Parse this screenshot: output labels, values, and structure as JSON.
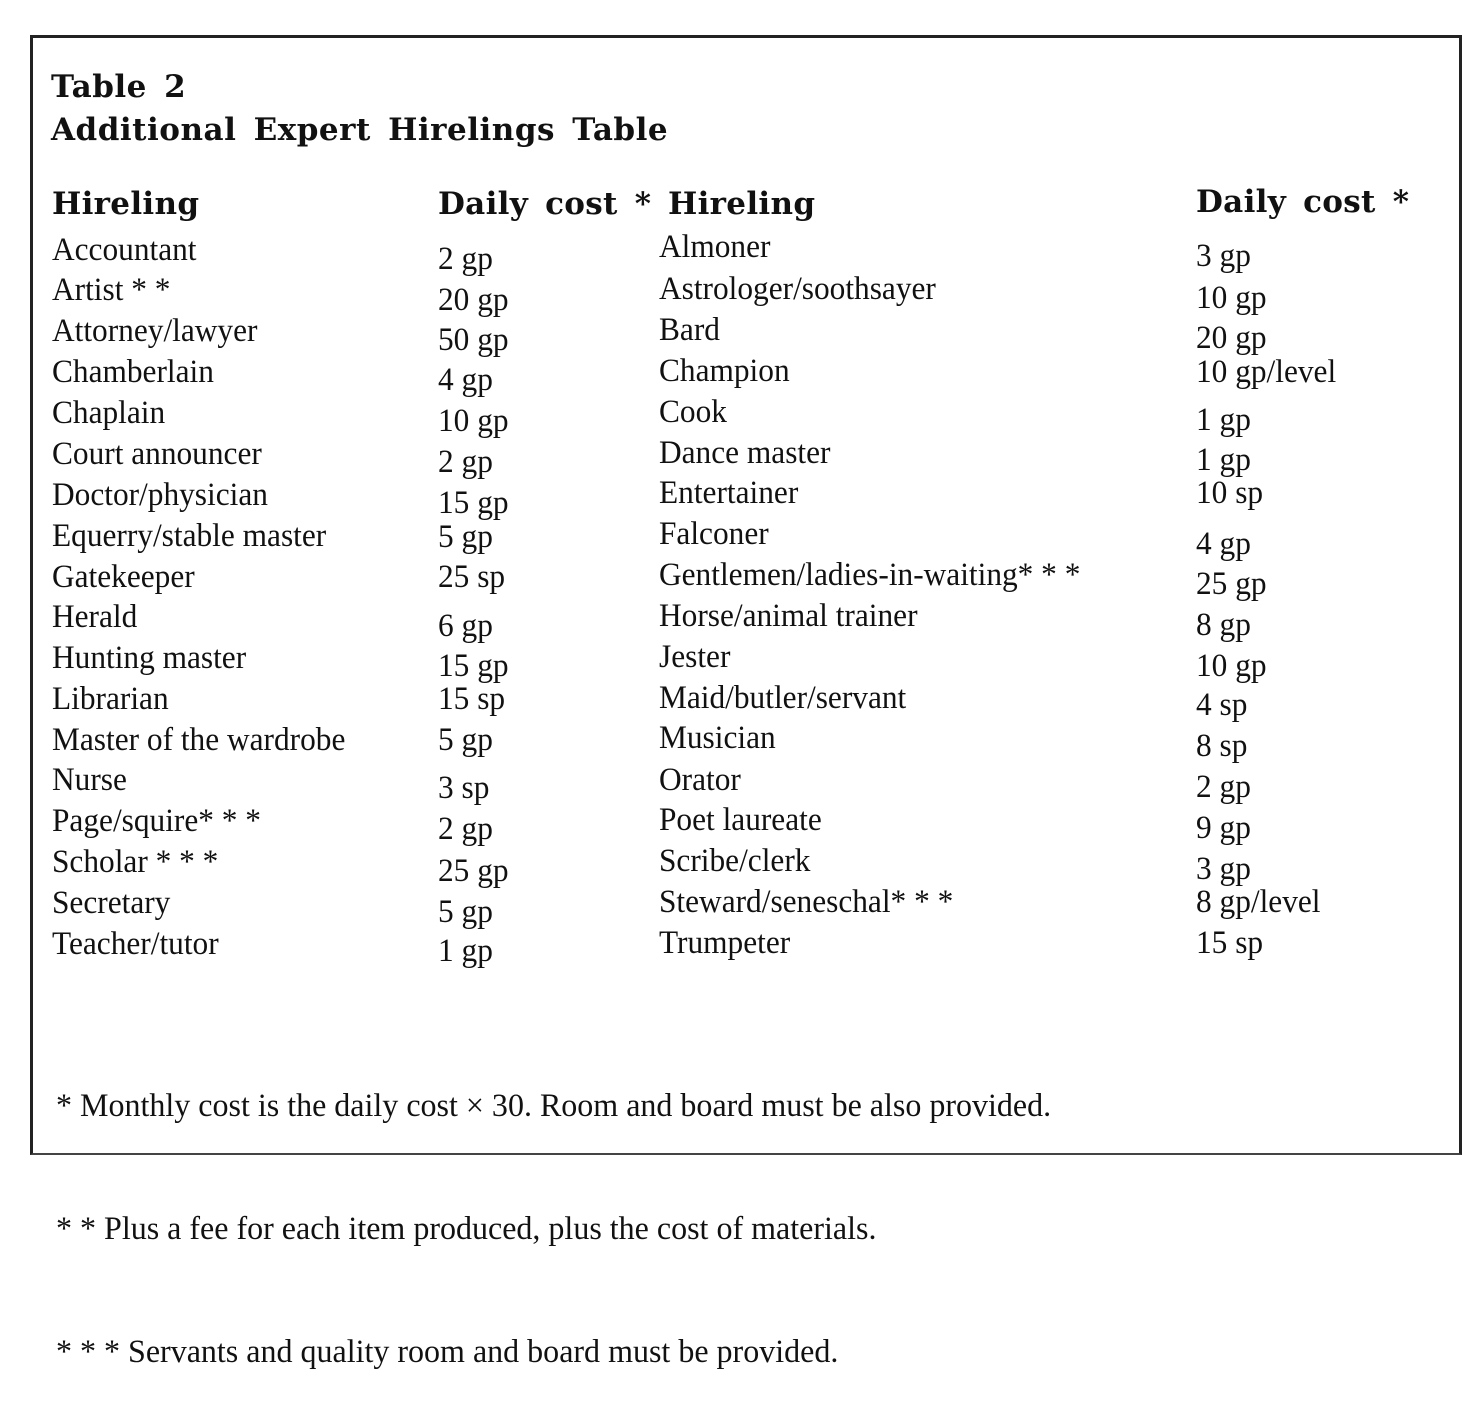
{
  "table": {
    "number_label": "Table 2",
    "title": "Additional Expert Hirelings Table",
    "headers": {
      "left_hireling": "Hireling",
      "left_cost": "Daily cost *",
      "right_hireling": "Hireling",
      "right_cost": "Daily cost *"
    },
    "left_rows": [
      {
        "hireling": "Accountant",
        "cost": "2 gp"
      },
      {
        "hireling": "Artist * *",
        "cost": "20 gp"
      },
      {
        "hireling": "Attorney/lawyer",
        "cost": "50 gp"
      },
      {
        "hireling": "Chamberlain",
        "cost": "4 gp"
      },
      {
        "hireling": "Chaplain",
        "cost": "10 gp"
      },
      {
        "hireling": "Court announcer",
        "cost": "2 gp"
      },
      {
        "hireling": "Doctor/physician",
        "cost": "15 gp"
      },
      {
        "hireling": "Equerry/stable master",
        "cost": "5 gp"
      },
      {
        "hireling": "Gatekeeper",
        "cost": "25 sp"
      },
      {
        "hireling": "Herald",
        "cost": "6 gp"
      },
      {
        "hireling": "Hunting master",
        "cost": "15 gp"
      },
      {
        "hireling": "Librarian",
        "cost": "15 sp"
      },
      {
        "hireling": "Master of the wardrobe",
        "cost": "5 gp"
      },
      {
        "hireling": "Nurse",
        "cost": "3 sp"
      },
      {
        "hireling": "Page/squire* * *",
        "cost": "2 gp"
      },
      {
        "hireling": "Scholar * * *",
        "cost": "25 gp"
      },
      {
        "hireling": "Secretary",
        "cost": "5 gp"
      },
      {
        "hireling": "Teacher/tutor",
        "cost": "1 gp"
      }
    ],
    "right_rows": [
      {
        "hireling": "Almoner",
        "cost": "3 gp"
      },
      {
        "hireling": "Astrologer/soothsayer",
        "cost": "10 gp"
      },
      {
        "hireling": "Bard",
        "cost": "20 gp"
      },
      {
        "hireling": "Champion",
        "cost": "10 gp/level"
      },
      {
        "hireling": "Cook",
        "cost": "1 gp"
      },
      {
        "hireling": "Dance master",
        "cost": "1 gp"
      },
      {
        "hireling": "Entertainer",
        "cost": "10 sp"
      },
      {
        "hireling": "Falconer",
        "cost": "4 gp"
      },
      {
        "hireling": "Gentlemen/ladies-in-waiting* * *",
        "cost": "25 gp"
      },
      {
        "hireling": "Horse/animal trainer",
        "cost": "8 gp"
      },
      {
        "hireling": "Jester",
        "cost": "10 gp"
      },
      {
        "hireling": "Maid/butler/servant",
        "cost": "4 sp"
      },
      {
        "hireling": "Musician",
        "cost": "8 sp"
      },
      {
        "hireling": "Orator",
        "cost": "2 gp"
      },
      {
        "hireling": "Poet laureate",
        "cost": "9 gp"
      },
      {
        "hireling": "Scribe/clerk",
        "cost": "3 gp"
      },
      {
        "hireling": "Steward/seneschal* * *",
        "cost": "8 gp/level"
      },
      {
        "hireling": "Trumpeter",
        "cost": "15 sp"
      }
    ],
    "footnotes": [
      "* Monthly cost is the daily cost × 30. Room and board must be also provided.",
      "* * Plus a fee for each item produced, plus the cost of materials.",
      "* * * Servants and quality room and board must be provided."
    ]
  }
}
